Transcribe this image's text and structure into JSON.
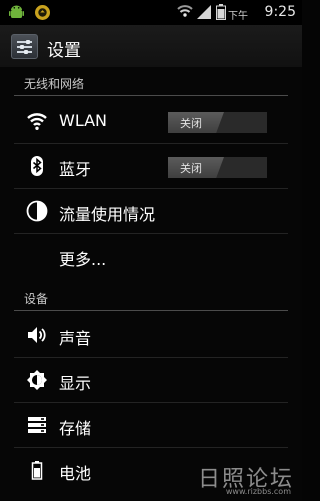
{
  "status_bar": {
    "ampm": "下午",
    "time": "9:25",
    "icons": [
      "android-notification-icon",
      "sync-notification-icon",
      "wifi-signal-icon",
      "cell-signal-icon",
      "battery-icon"
    ]
  },
  "action_bar": {
    "title": "设置",
    "icon": "settings-sliders-icon"
  },
  "sections": [
    {
      "header": "无线和网络",
      "items": [
        {
          "label": "WLAN",
          "icon": "wifi-icon",
          "toggle": "关闭"
        },
        {
          "label": "蓝牙",
          "icon": "bluetooth-icon",
          "toggle": "关闭"
        },
        {
          "label": "流量使用情况",
          "icon": "data-usage-icon"
        },
        {
          "label": "更多..."
        }
      ]
    },
    {
      "header": "设备",
      "items": [
        {
          "label": "声音",
          "icon": "speaker-icon"
        },
        {
          "label": "显示",
          "icon": "brightness-icon"
        },
        {
          "label": "存储",
          "icon": "storage-icon"
        },
        {
          "label": "电池",
          "icon": "battery-icon"
        }
      ]
    }
  ],
  "watermark": {
    "text": "日照论坛",
    "url": "www.rizbbs.com"
  }
}
